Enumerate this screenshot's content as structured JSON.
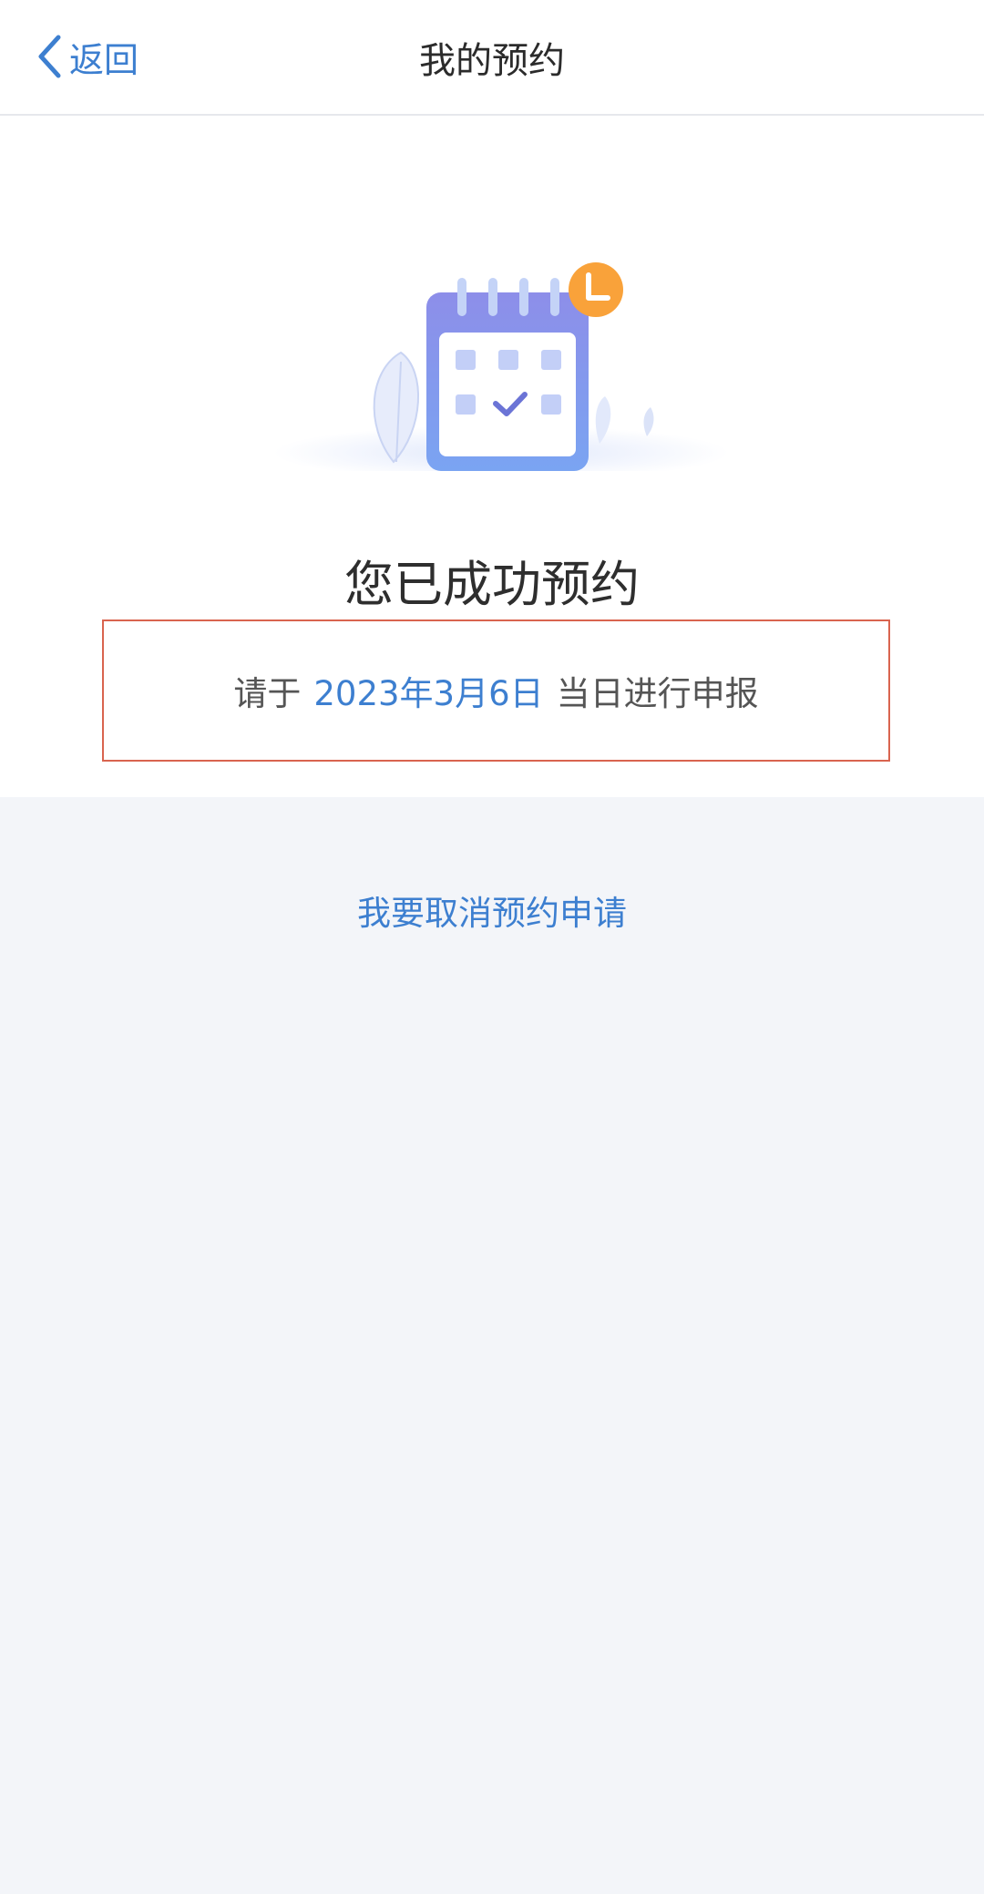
{
  "nav": {
    "back_label": "返回",
    "title": "我的预约"
  },
  "main": {
    "illustration_icon": "calendar-clock-illustration",
    "success_title": "您已成功预约",
    "date_line": {
      "prefix": "请于",
      "date": "2023年3月6日",
      "suffix": "当日进行申报"
    },
    "cancel_link": "我要取消预约申请"
  },
  "colors": {
    "accent": "#3d7fd0",
    "highlight_border": "#d9644f",
    "background": "#f3f5f9",
    "clock_badge": "#f9a23a"
  }
}
